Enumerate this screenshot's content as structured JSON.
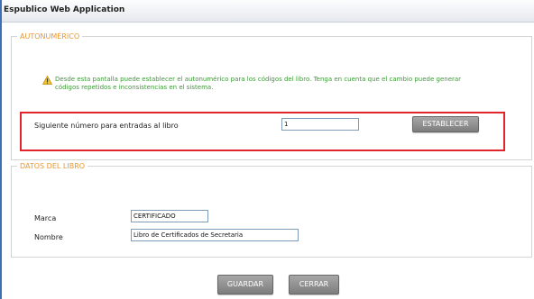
{
  "window": {
    "title": "Espublico Web Application"
  },
  "autonumerico": {
    "legend": "AUTONUMÉRICO",
    "warning_icon": "warning-triangle-icon",
    "warning_line1": "Desde esta pantalla puede establecer el autonumérico para los códigos del libro. Tenga en cuenta que el cambio puede generar",
    "warning_line2": "códigos repetidos e inconsistencias en el sistema.",
    "label": "Siguiente número para entradas al libro",
    "value": "1",
    "button": "ESTABLECER"
  },
  "datos": {
    "legend": "DATOS DEL LIBRO",
    "marca_label": "Marca",
    "marca_value": "CERTIFICADO",
    "nombre_label": "Nombre",
    "nombre_value": "Libro de Certificados de Secretaria"
  },
  "footer": {
    "save": "GUARDAR",
    "close": "CERRAR"
  },
  "colors": {
    "legend": "#e8962e",
    "warning_text": "#3a9a34",
    "highlight": "#e2252b",
    "button": "#8c8c8c"
  }
}
